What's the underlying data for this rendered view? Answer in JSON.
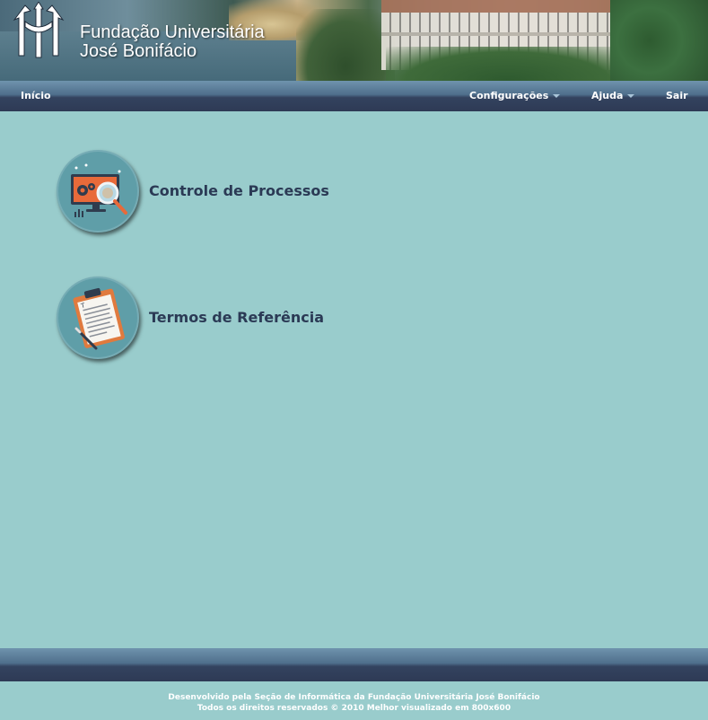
{
  "header": {
    "org_name_line1": "Fundação Universitária",
    "org_name_line2": "José Bonifácio"
  },
  "nav": {
    "home": "Início",
    "settings": "Configurações",
    "help": "Ajuda",
    "logout": "Sair"
  },
  "menu": {
    "items": [
      {
        "label": "Controle de Processos",
        "icon": "monitor-gear-magnifier-icon"
      },
      {
        "label": "Termos de Referência",
        "icon": "clipboard-document-icon"
      }
    ]
  },
  "footer": {
    "line1": "Desenvolvido pela Seção de Informática da Fundação Universitária José Bonifácio",
    "line2": "Todos os direitos reservados © 2010 Melhor visualizado em 800x600"
  },
  "colors": {
    "background": "#99cccc",
    "nav_dark": "#2e3a55",
    "nav_light": "#6f93ad",
    "label_text": "#2b3a55",
    "icon_circle": "#5f9ea8"
  }
}
